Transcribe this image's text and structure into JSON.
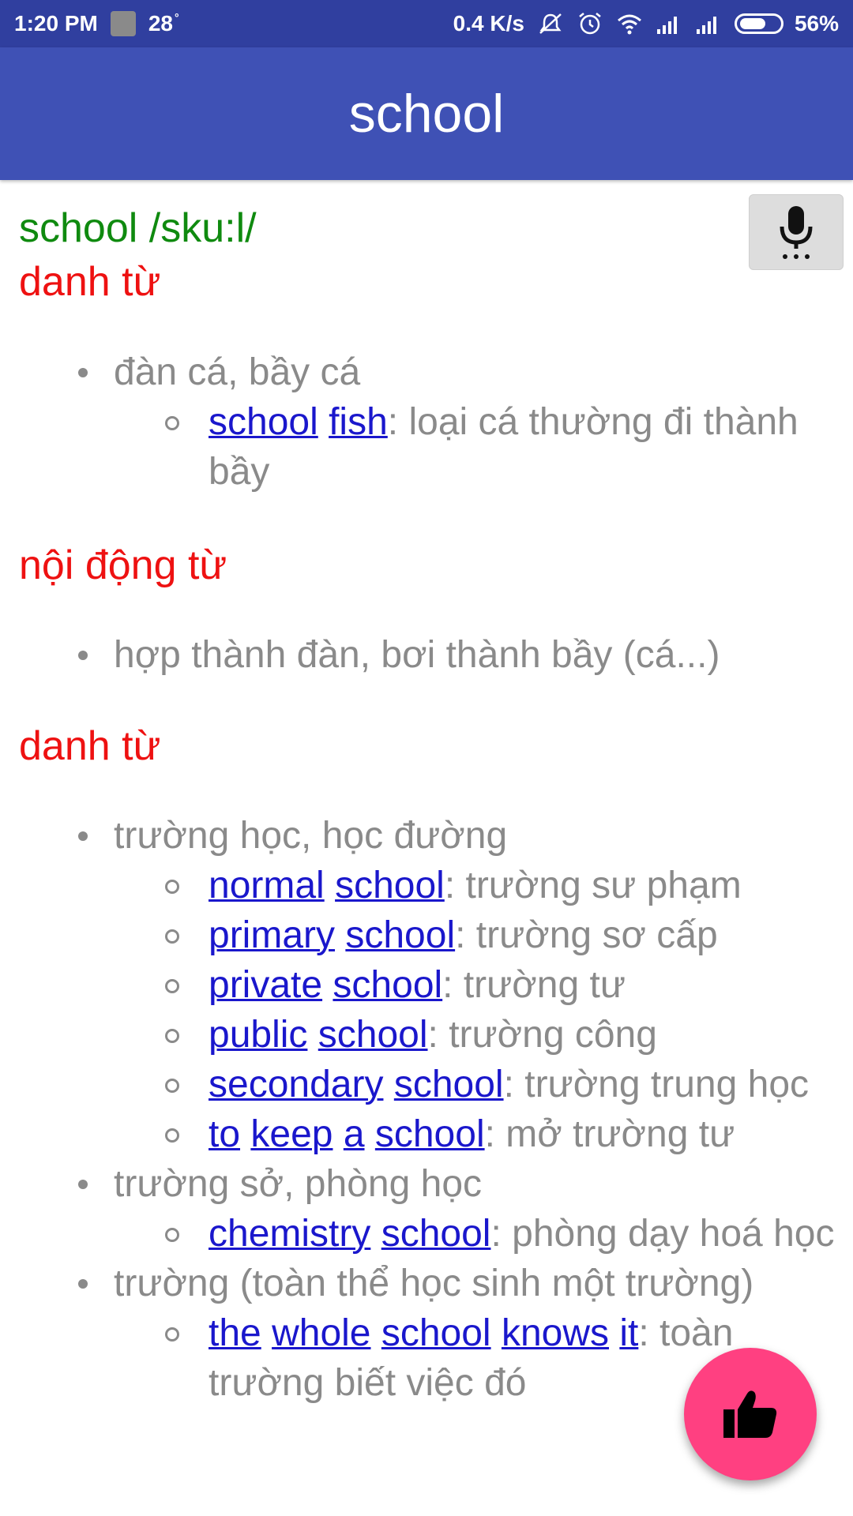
{
  "status_bar": {
    "time": "1:20 PM",
    "temperature": "28",
    "degree": "°",
    "net_speed": "0.4 K/s",
    "battery": "56%",
    "icons": [
      "app-notification-icon",
      "mute-icon",
      "alarm-icon",
      "wifi-icon",
      "signal-icon",
      "signal-icon",
      "battery-icon"
    ]
  },
  "app_bar": {
    "title": "school"
  },
  "entry": {
    "headword": "school /sku:l/",
    "mic_icon": "microphone-icon",
    "sections": [
      {
        "pos": "danh từ",
        "senses": [
          {
            "meaning": "đàn cá, bầy cá",
            "examples": [
              {
                "words": [
                  "school",
                  "fish"
                ],
                "translation": ": loại cá thường đi thành bầy"
              }
            ]
          }
        ]
      },
      {
        "pos": "nội động từ",
        "senses": [
          {
            "meaning": "hợp thành đàn, bơi thành bầy (cá...)",
            "examples": []
          }
        ]
      },
      {
        "pos": "danh từ",
        "senses": [
          {
            "meaning": "trường học, học đường",
            "examples": [
              {
                "words": [
                  "normal",
                  "school"
                ],
                "translation": ": trường sư phạm"
              },
              {
                "words": [
                  "primary",
                  "school"
                ],
                "translation": ": trường sơ cấp"
              },
              {
                "words": [
                  "private",
                  "school"
                ],
                "translation": ": trường tư"
              },
              {
                "words": [
                  "public",
                  "school"
                ],
                "translation": ": trường công"
              },
              {
                "words": [
                  "secondary",
                  "school"
                ],
                "translation": ": trường trung học"
              },
              {
                "words": [
                  "to",
                  "keep",
                  "a",
                  "school"
                ],
                "translation": ": mở trường tư"
              }
            ]
          },
          {
            "meaning": "trường sở, phòng học",
            "examples": [
              {
                "words": [
                  "chemistry",
                  "school"
                ],
                "translation": ": phòng dạy hoá học"
              }
            ]
          },
          {
            "meaning": "trường (toàn thể học sinh một trường)",
            "examples": [
              {
                "words": [
                  "the",
                  "whole",
                  "school",
                  "knows",
                  "it"
                ],
                "translation": ": toàn trường biết việc đó"
              }
            ]
          }
        ]
      }
    ]
  },
  "fab": {
    "icon": "thumbs-up-icon"
  }
}
